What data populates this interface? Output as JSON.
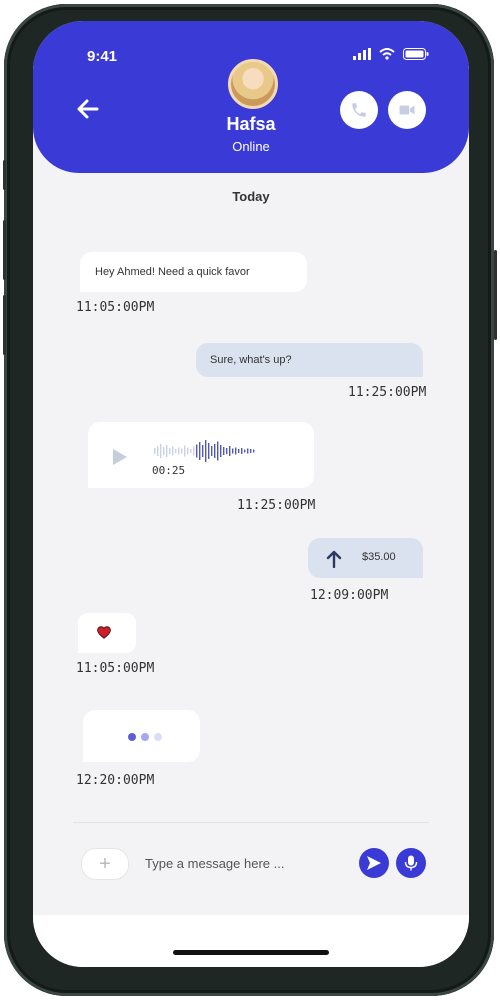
{
  "status_bar": {
    "time": "9:41"
  },
  "header": {
    "contact_name": "Hafsa",
    "contact_status": "Online"
  },
  "chat": {
    "date_label": "Today",
    "messages": [
      {
        "direction": "incoming",
        "type": "text",
        "text": "Hey Ahmed! Need a quick favor",
        "time": "11:05:00PM"
      },
      {
        "direction": "outgoing",
        "type": "text",
        "text": "Sure, what's up?",
        "time": "11:25:00PM"
      },
      {
        "direction": "incoming",
        "type": "voice",
        "duration": "00:25",
        "played_fraction": 0.4,
        "time": "11:25:00PM"
      },
      {
        "direction": "outgoing",
        "type": "payment",
        "amount": "$35.00",
        "icon": "arrow-up-icon",
        "time": "12:09:00PM"
      },
      {
        "direction": "incoming",
        "type": "reaction",
        "icon": "heart-icon",
        "time": "11:05:00PM"
      },
      {
        "direction": "incoming",
        "type": "typing",
        "time": "12:20:00PM"
      }
    ]
  },
  "composer": {
    "placeholder": "Type a message here ..."
  },
  "colors": {
    "accent": "#3a3ad6",
    "outgoing_bubble": "#d9e2ee",
    "incoming_bubble": "#ffffff",
    "background": "#f3f3f5",
    "heart": "#d11f2a"
  }
}
